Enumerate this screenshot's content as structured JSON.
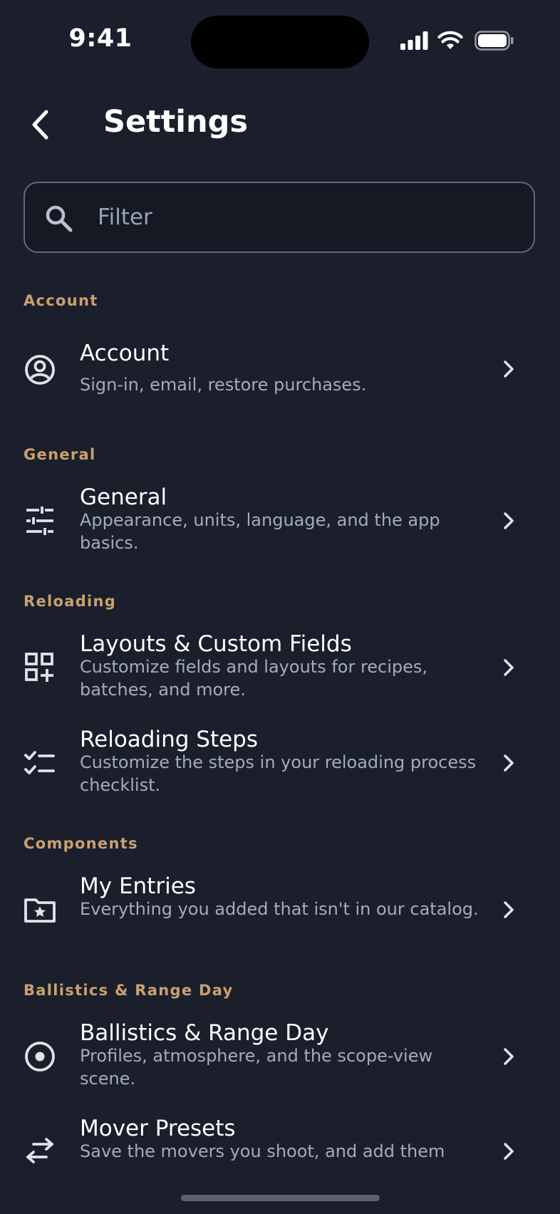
{
  "status_bar": {
    "time": "9:41"
  },
  "header": {
    "title": "Settings",
    "back_icon": "chevron-left-icon"
  },
  "search": {
    "placeholder": "Filter",
    "value": "",
    "icon": "search-icon"
  },
  "colors": {
    "background": "#1a1f2b",
    "section_header": "#cba06f",
    "title_text": "#ffffff",
    "subtitle_text": "#a3acbb",
    "search_border": "#5d6a80"
  },
  "sections": [
    {
      "header": "Account",
      "items": [
        {
          "icon": "account-circle-icon",
          "title": "Account",
          "subtitle": "Sign-in, email, restore purchases."
        }
      ]
    },
    {
      "header": "General",
      "items": [
        {
          "icon": "sliders-icon",
          "title": "General",
          "subtitle": "Appearance, units, language, and the app basics."
        }
      ]
    },
    {
      "header": "Reloading",
      "items": [
        {
          "icon": "grid-add-icon",
          "title": "Layouts & Custom Fields",
          "subtitle": "Customize fields and layouts for recipes, batches, and more."
        },
        {
          "icon": "checklist-icon",
          "title": "Reloading Steps",
          "subtitle": "Customize the steps in your reloading process checklist."
        }
      ]
    },
    {
      "header": "Components",
      "items": [
        {
          "icon": "folder-star-icon",
          "title": "My Entries",
          "subtitle": "Everything you added that isn't in our catalog."
        }
      ]
    },
    {
      "header": "Ballistics & Range Day",
      "items": [
        {
          "icon": "target-icon",
          "title": "Ballistics & Range Day",
          "subtitle": "Profiles, atmosphere, and the scope-view scene."
        },
        {
          "icon": "swap-arrows-icon",
          "title": "Mover Presets",
          "subtitle": "Save the movers you shoot, and add them"
        }
      ]
    }
  ]
}
